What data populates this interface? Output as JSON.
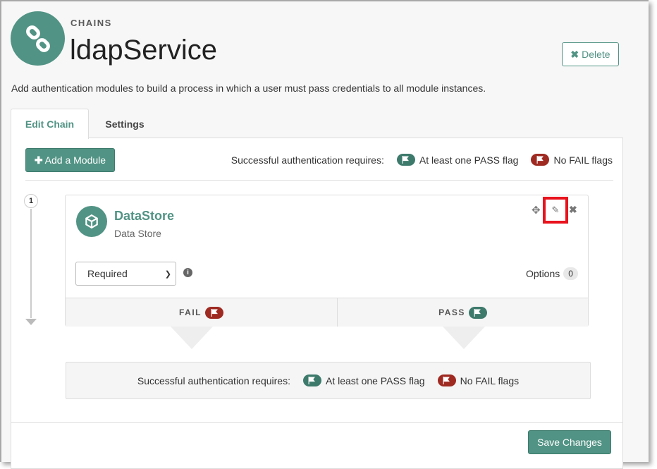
{
  "header": {
    "eyebrow": "CHAINS",
    "title": "ldapService",
    "delete_label": "Delete",
    "description": "Add authentication modules to build a process in which a user must pass credentials to all module instances."
  },
  "tabs": [
    {
      "label": "Edit Chain",
      "active": true
    },
    {
      "label": "Settings",
      "active": false
    }
  ],
  "toolbar": {
    "add_label": "Add a Module",
    "requires_label": "Successful authentication requires:",
    "pass_label": "At least one PASS flag",
    "fail_label": "No FAIL flags"
  },
  "module": {
    "step": "1",
    "name": "DataStore",
    "type": "Data Store",
    "criteria": "Required",
    "options_label": "Options",
    "options_count": "0",
    "fail_label": "FAIL",
    "pass_label": "PASS"
  },
  "footer": {
    "requires_label": "Successful authentication requires:",
    "pass_label": "At least one PASS flag",
    "fail_label": "No FAIL flags",
    "save_label": "Save Changes"
  },
  "colors": {
    "accent": "#519384",
    "pass": "#3d7a6c",
    "fail": "#9e2a22",
    "highlight": "#e8131d"
  }
}
